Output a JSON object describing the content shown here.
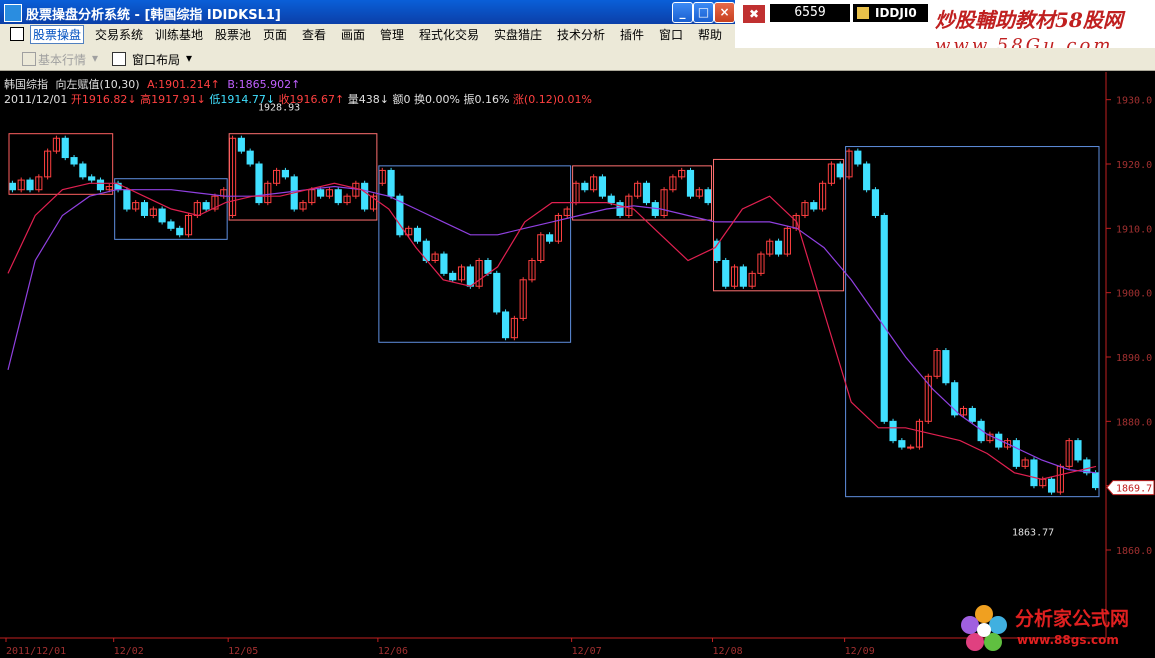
{
  "window": {
    "title": "股票操盘分析系统 - [韩国综指 IDIDKSL1]",
    "minimize": "_",
    "maximize": "□",
    "close": "×"
  },
  "quote_panel": {
    "code": "6559",
    "name": "IDDJI0"
  },
  "watermark": {
    "line1": "炒股輔助教材58股网",
    "line2": "www.58Gu.com"
  },
  "menu": [
    "股票操盘",
    "交易系统",
    "训练基地",
    "股票池",
    "页面",
    "查看",
    "画面",
    "管理",
    "程式化交易",
    "实盘猎庄",
    "技术分析",
    "插件",
    "窗口",
    "帮助"
  ],
  "toolbar": {
    "basic_quote": "基本行情",
    "window_layout": "窗口布局"
  },
  "info": {
    "name": "韩国综指",
    "indicator": "向左赋值(10,30)",
    "a_value": "A:1901.214↑",
    "b_value": "B:1865.902↑",
    "date": "2011/12/01",
    "open": "开1916.82↓",
    "high": "高1917.91↓",
    "low": "低1914.77↓",
    "close": "收1916.67↑",
    "volume": "量438↓",
    "amount": "额0",
    "turnover": "换0.00%",
    "amplitude": "振0.16%",
    "change": "涨(0.12)0.01%"
  },
  "colors": {
    "up": "#ff4040",
    "down": "#40e0ff",
    "ma_short": "#e02050",
    "ma_long": "#9040e0",
    "axis": "#c02020"
  },
  "chart_data": {
    "type": "candlestick",
    "y_ticks": [
      1930,
      1920,
      1910,
      1900,
      1890,
      1880,
      1870,
      1860
    ],
    "y_tick_labels": [
      "1930.0",
      "1920.0",
      "1910.0",
      "1900.0",
      "1890.0",
      "1880.0",
      "1870.0",
      "1860.0"
    ],
    "ylim": [
      1856,
      1936
    ],
    "x_tick_labels": [
      "2011/12/01",
      "12/02",
      "12/05",
      "12/06",
      "12/07",
      "12/08",
      "12/09"
    ],
    "last_price": "1869.7",
    "annotations": [
      {
        "text": "1928.93",
        "value": 1928.93
      },
      {
        "text": "1863.77",
        "value": 1863.77
      }
    ],
    "days": [
      {
        "label": "12/01",
        "path": [
          1917,
          1916,
          1917.5,
          1916,
          1918,
          1922,
          1924,
          1921,
          1920,
          1918,
          1917.5,
          1916,
          1916.5
        ]
      },
      {
        "label": "12/02",
        "path": [
          1917,
          1916,
          1913,
          1914,
          1912,
          1913,
          1911,
          1910,
          1909,
          1912,
          1914,
          1913,
          1915,
          1916
        ]
      },
      {
        "label": "12/05",
        "path": [
          1912,
          1924,
          1922,
          1920,
          1914,
          1917,
          1919,
          1918,
          1913,
          1914,
          1916,
          1915,
          1916,
          1914,
          1915,
          1917,
          1913,
          1915
        ]
      },
      {
        "label": "12/06",
        "path": [
          1917,
          1919,
          1915,
          1909,
          1910,
          1908,
          1905,
          1906,
          1903,
          1902,
          1904,
          1901,
          1905,
          1903,
          1897,
          1893,
          1896,
          1902,
          1905,
          1909,
          1908,
          1912,
          1913
        ]
      },
      {
        "label": "12/07",
        "path": [
          1914,
          1917,
          1916,
          1918,
          1915,
          1914,
          1912,
          1915,
          1917,
          1914,
          1912,
          1916,
          1918,
          1919,
          1915,
          1916,
          1914
        ]
      },
      {
        "label": "12/08",
        "path": [
          1908,
          1905,
          1901,
          1904,
          1901,
          1903,
          1906,
          1908,
          1906,
          1910,
          1912,
          1914,
          1913,
          1917,
          1920,
          1918
        ]
      },
      {
        "label": "12/09",
        "path": [
          1918,
          1922,
          1920,
          1916,
          1912,
          1880,
          1877,
          1876,
          1876,
          1880,
          1887,
          1891,
          1886,
          1881,
          1882,
          1880,
          1877,
          1878,
          1876,
          1877,
          1873,
          1874,
          1870,
          1871,
          1869,
          1873,
          1877,
          1874,
          1872,
          1869.7
        ]
      }
    ],
    "ma_short": [
      1903,
      1912,
      1916,
      1917,
      1917,
      1915,
      1913,
      1912,
      1914,
      1915,
      1915,
      1916,
      1917,
      1916,
      1913,
      1907,
      1902,
      1901,
      1904,
      1911,
      1914,
      1914,
      1914,
      1913,
      1909,
      1905,
      1907,
      1913,
      1915,
      1911,
      1897,
      1883,
      1879,
      1879,
      1878,
      1877,
      1875,
      1872,
      1871,
      1872,
      1873
    ],
    "ma_long": [
      1888,
      1905,
      1912,
      1915,
      1916,
      1916,
      1916,
      1915.5,
      1915,
      1915,
      1915.5,
      1916,
      1916.5,
      1916,
      1915,
      1913,
      1911,
      1909,
      1909,
      1910,
      1911,
      1912,
      1913,
      1913.5,
      1913,
      1912,
      1911,
      1911,
      1911,
      1910,
      1907,
      1902,
      1896,
      1890,
      1885,
      1881,
      1878,
      1876,
      1874,
      1872.5,
      1872
    ]
  },
  "logo": {
    "title": "分析家公式网",
    "url": "www.88gs.com"
  }
}
